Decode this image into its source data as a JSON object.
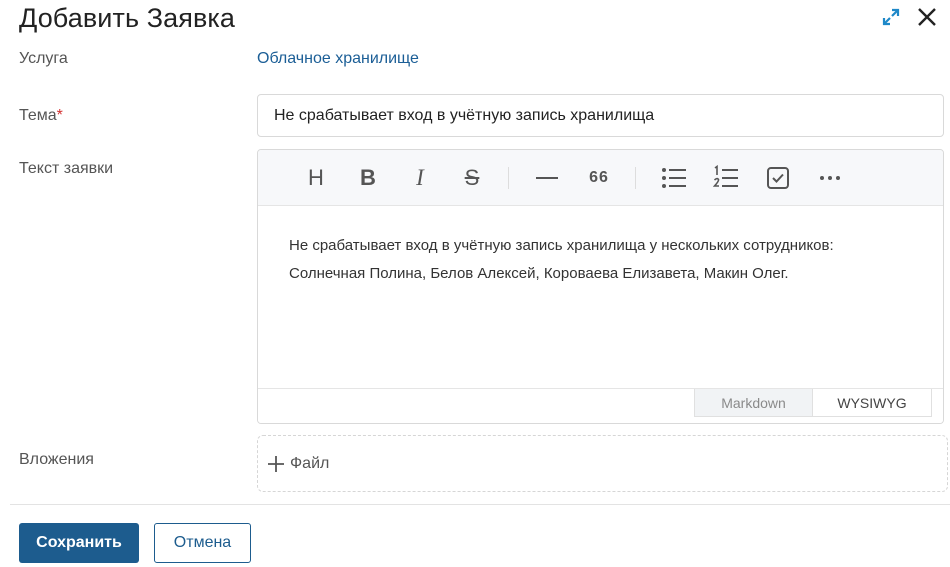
{
  "dialog": {
    "title": "Добавить Заявка"
  },
  "fields": {
    "service_label": "Услуга",
    "service_value": "Облачное хранилище",
    "subject_label": "Тема",
    "subject_required_mark": "*",
    "subject_value": "Не срабатывает вход в учётную запись хранилища",
    "text_label": "Текст заявки",
    "attachments_label": "Вложения"
  },
  "editor": {
    "toolbar": {
      "heading": "H",
      "bold": "B",
      "italic": "I",
      "strike": "S",
      "quote": "66"
    },
    "content": "Не срабатывает вход в учётную запись хранилища у нескольких сотрудников: Солнечная Полина, Белов Алексей, Короваева Елизавета, Макин Олег.",
    "modes": [
      "Markdown",
      "WYSIWYG"
    ],
    "active_mode": "WYSIWYG"
  },
  "attachments": {
    "add_file_label": "Файл"
  },
  "actions": {
    "save_label": "Сохранить",
    "cancel_label": "Отмена"
  },
  "colors": {
    "primary": "#1d5c8e",
    "link": "#1b5e96",
    "required": "#d32f2f",
    "expand_icon": "#1e88c8"
  },
  "icons": {
    "expand": "expand-icon",
    "close": "close-icon",
    "horizontal_rule": "horizontal-rule-icon",
    "bullet_list": "bullet-list-icon",
    "numbered_list": "numbered-list-icon",
    "checkbox": "checkbox-icon",
    "more": "more-icon",
    "add": "plus-icon"
  }
}
